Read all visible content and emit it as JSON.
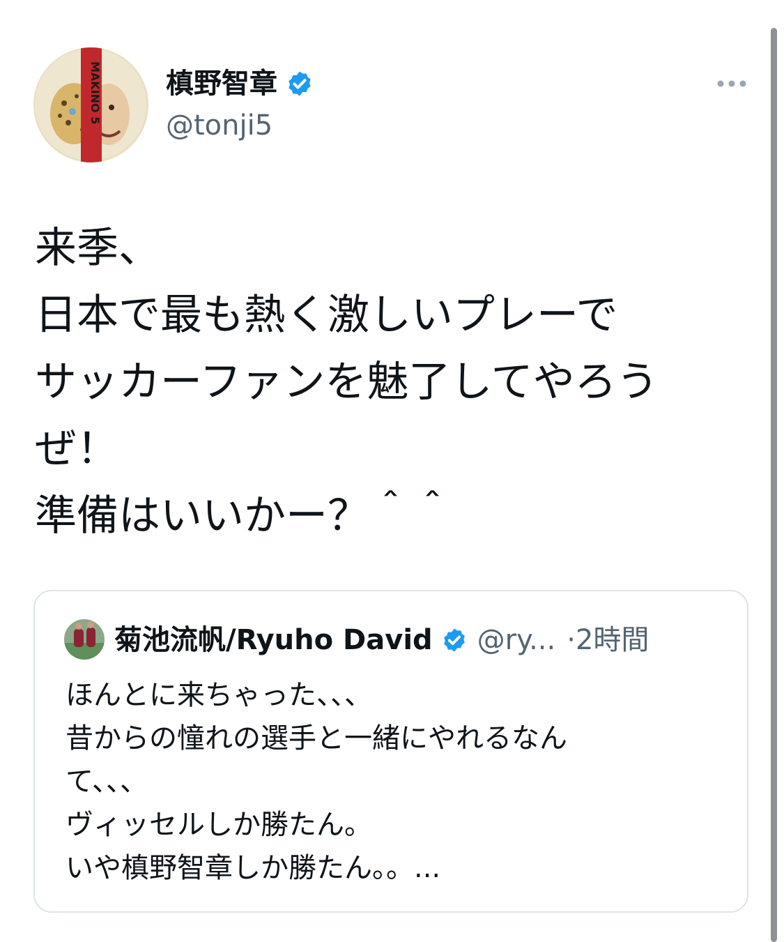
{
  "author": {
    "display_name": "槙野智章",
    "handle": "@tonji5",
    "verified": true,
    "avatar_text": "MAKINO 5"
  },
  "tweet": {
    "lines": [
      "来季、",
      "日本で最も熱く激しいプレーで",
      "サッカーファンを魅了してやろう",
      "ぜ！",
      "準備はいいかー？＾＾"
    ]
  },
  "quoted_tweet": {
    "display_name": "菊池流帆/Ryuho David",
    "handle": "@ry...",
    "time": "·2時間",
    "verified": true,
    "lines": [
      "ほんとに来ちゃった、、、",
      "昔からの憧れの選手と一緒にやれるなん",
      "て、、、",
      "ヴィッセルしか勝たん。",
      "いや槙野智章しか勝たん。。..."
    ]
  },
  "colors": {
    "verified_blue": "#1d9bf0",
    "secondary_text": "#536471",
    "border": "#dde3e7",
    "avatar_stripe": "#c0282d"
  },
  "icons": [
    "verified-badge-icon",
    "more-options-icon"
  ]
}
